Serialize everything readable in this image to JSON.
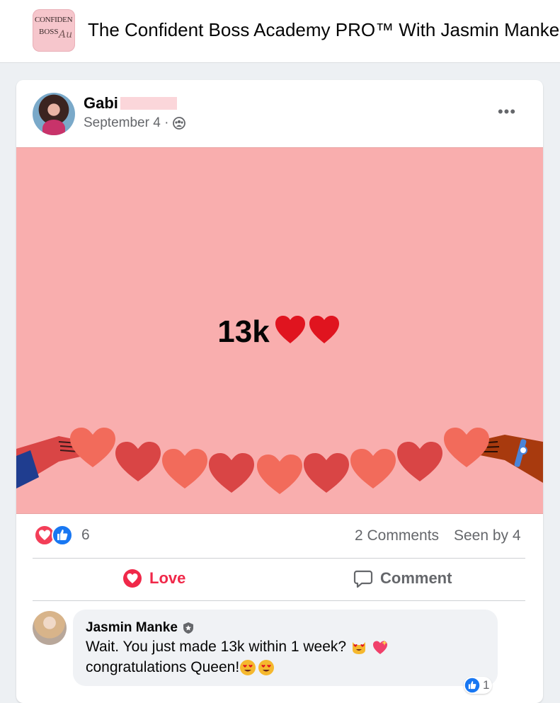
{
  "group": {
    "logo_line1": "CONFIDEN",
    "logo_line2": "BOSS",
    "logo_script": "Au",
    "title": "The Confident Boss Academy PRO™ With Jasmin Manke"
  },
  "post": {
    "poster_name": "Gabi",
    "date": "September 4 ·",
    "privacy_icon": "group-icon",
    "more_label": "•••",
    "image_text": "13k",
    "image_emoji": "two red hearts",
    "image_bg": "#f9aeae"
  },
  "stats": {
    "reactions": [
      "love",
      "like"
    ],
    "reaction_count": "6",
    "comments": "2 Comments",
    "seen_by": "Seen by 4"
  },
  "actions": {
    "love_label": "Love",
    "comment_label": "Comment",
    "love_color": "#f02849"
  },
  "comment": {
    "name": "Jasmin Manke",
    "badge_icon": "admin-shield-icon",
    "line1": "Wait. You just made 13k within 1 week?",
    "line2": "congratulations Queen!",
    "like_count": "1"
  }
}
